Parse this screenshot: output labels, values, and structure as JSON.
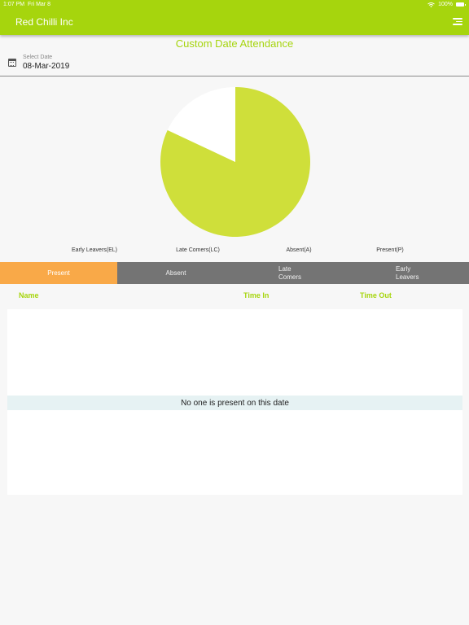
{
  "status_bar": {
    "time": "1:07 PM",
    "date": "Fri Mar 8",
    "battery": "100%"
  },
  "app": {
    "title": "Red Chilli Inc",
    "accent_color": "#a6d50d",
    "menu_icon": "hamburger-menu-icon"
  },
  "page": {
    "heading": "Custom Date Attendance"
  },
  "date_picker": {
    "label": "Select Date",
    "value": "08-Mar-2019",
    "icon": "calendar-icon"
  },
  "chart_data": {
    "type": "pie",
    "title": "",
    "categories": [
      "Early Leavers(EL)",
      "Late Comers(LC)",
      "Absent(A)",
      "Present(P)"
    ],
    "values": [
      0,
      0,
      0.18,
      0.82
    ],
    "colors": [
      "#a6d50d",
      "#ff9f40",
      "#ffffff",
      "#cfdf3a"
    ],
    "legend_position": "bottom"
  },
  "tabs": [
    {
      "label": "Present",
      "active": true
    },
    {
      "label": "Absent",
      "active": false
    },
    {
      "label": "Late Comers",
      "active": false
    },
    {
      "label": "Early Leavers",
      "active": false
    }
  ],
  "table": {
    "columns": [
      "Name",
      "Time In",
      "Time Out"
    ],
    "empty_message": "No one is present on this date"
  }
}
